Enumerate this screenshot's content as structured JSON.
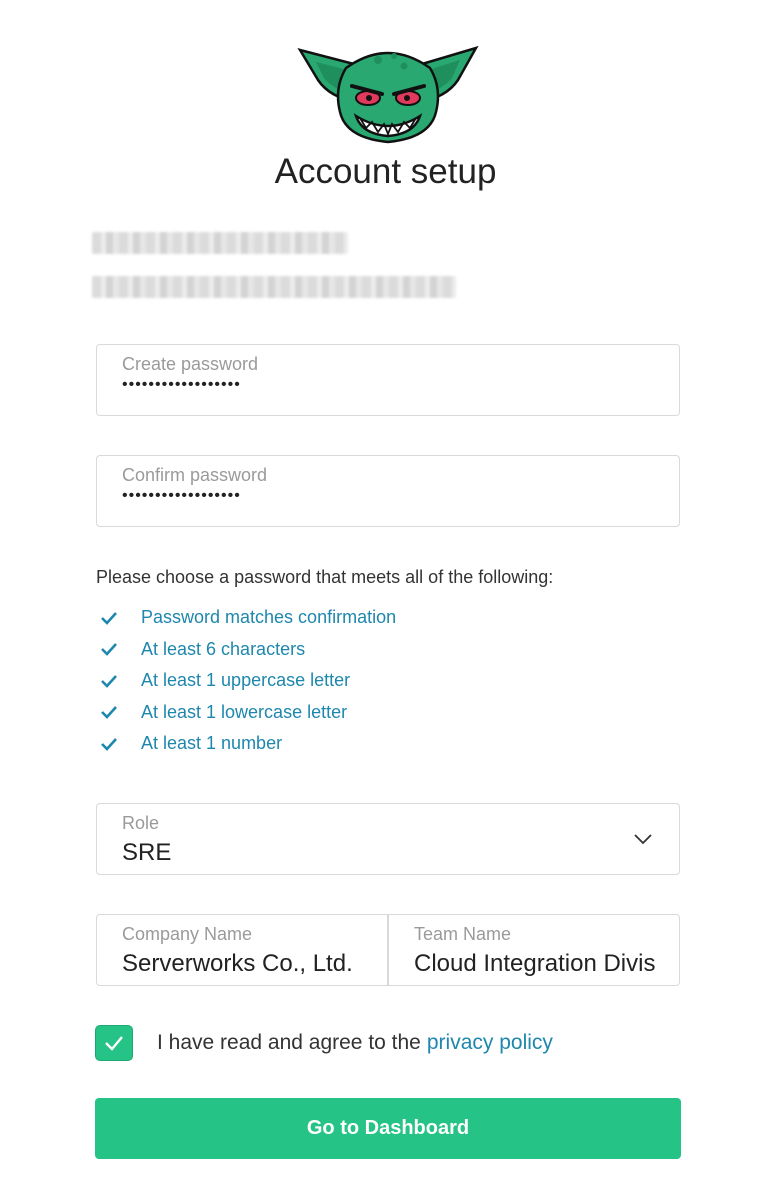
{
  "page": {
    "title": "Account setup"
  },
  "user": {
    "name_redacted": "",
    "email_redacted": ""
  },
  "form": {
    "password": {
      "label": "Create password",
      "masked_value": "••••••••••••••••••"
    },
    "confirm": {
      "label": "Confirm password",
      "masked_value": "••••••••••••••••••"
    },
    "role": {
      "label": "Role",
      "value": "SRE",
      "icon": "chevron-down-icon"
    },
    "company": {
      "label": "Company Name",
      "value": "Serverworks Co., Ltd."
    },
    "team": {
      "label": "Team Name",
      "value": "Cloud Integration Division"
    }
  },
  "requirements": {
    "intro": "Please choose a password that meets all of the following:",
    "items": [
      {
        "label": "Password matches confirmation",
        "met": true
      },
      {
        "label": "At least 6 characters",
        "met": true
      },
      {
        "label": "At least 1 uppercase letter",
        "met": true
      },
      {
        "label": "At least 1 lowercase letter",
        "met": true
      },
      {
        "label": "At least 1 number",
        "met": true
      }
    ]
  },
  "agreement": {
    "checked": true,
    "text": "I have read and agree to the",
    "link": "privacy policy"
  },
  "actions": {
    "submit_label": "Go to Dashboard"
  },
  "colors": {
    "accent": "#25c486",
    "link": "#1e87ad",
    "border": "#d9d9d9",
    "logo_green": "#2aa871"
  }
}
